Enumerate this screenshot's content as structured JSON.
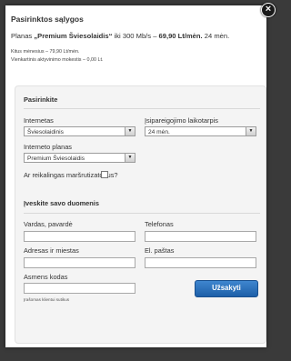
{
  "modal": {
    "title": "Pasirinktos sąlygos",
    "plan_prefix": "Planas ",
    "plan_name": "„Premium Šviesolaidis“",
    "plan_speed": " iki 300 Mb/s – ",
    "plan_price": "69,90 Lt/mėn.",
    "plan_term": " 24 mėn.",
    "monthly_fee": "Kitus mėnesius – 79,90 Lt/mėn.",
    "activation_fee": "Vienkartinis aktyvinimo mokestis – 0,00 Lt.",
    "close_icon": "close-icon"
  },
  "choose": {
    "title": "Pasirinkite",
    "internet_label": "Internetas",
    "internet_value": "Šviesolaidinis",
    "commitment_label": "Įsipareigojimo laikotarpis",
    "commitment_value": "24 mėn.",
    "plan_label": "Interneto planas",
    "plan_value": "Premium Šviesolaidis",
    "router_label": "Ar reikalingas maršrutizatorius?"
  },
  "details": {
    "title": "Įveskite savo duomenis",
    "name_label": "Vardas, pavardė",
    "phone_label": "Telefonas",
    "address_label": "Adresas ir miestas",
    "email_label": "El. paštas",
    "personal_code_label": "Asmens kodas",
    "personal_code_hint": "Įrašomas klientui sutikus",
    "submit_label": "Užsakyti"
  },
  "colors": {
    "button": "#2a6fba",
    "overlay": "#3a3a3a"
  }
}
